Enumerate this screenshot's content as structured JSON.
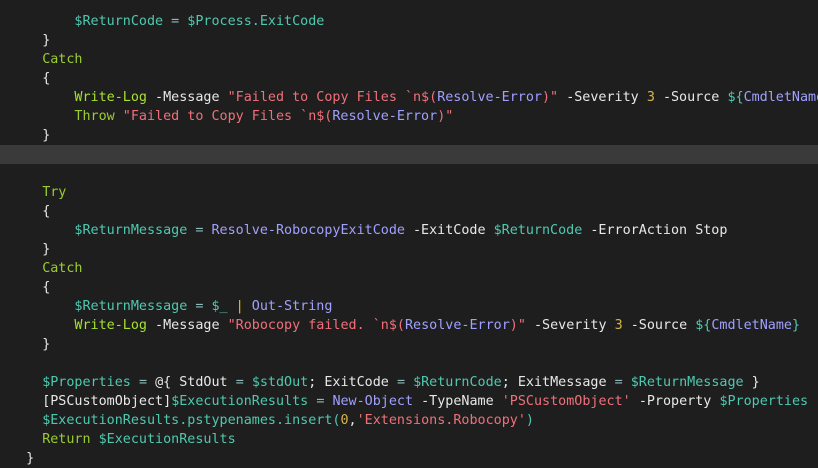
{
  "editor": {
    "current_line_index": 7,
    "colors": {
      "background": "#1e1e1e",
      "current_line": "#3a3a3a",
      "variable": "#4ec9b0",
      "keyword": "#9acd32",
      "command": "#a6e22e",
      "function_call": "#a0a0ff",
      "string": "#f0707a",
      "number": "#d6b64a",
      "operator": "#8fbcbb",
      "pipe": "#f0c000",
      "plain": "#e8e8e8"
    },
    "lines": [
      {
        "indent": 8,
        "tokens": [
          {
            "t": "$ReturnCode",
            "c": "var"
          },
          {
            "t": " ",
            "c": "plain"
          },
          {
            "t": "=",
            "c": "op"
          },
          {
            "t": " ",
            "c": "plain"
          },
          {
            "t": "$Process.ExitCode",
            "c": "var"
          }
        ]
      },
      {
        "indent": 4,
        "tokens": [
          {
            "t": "}",
            "c": "plain"
          }
        ]
      },
      {
        "indent": 4,
        "tokens": [
          {
            "t": "Catch",
            "c": "kw"
          }
        ]
      },
      {
        "indent": 4,
        "tokens": [
          {
            "t": "{",
            "c": "plain"
          }
        ]
      },
      {
        "indent": 8,
        "tokens": [
          {
            "t": "Write-Log",
            "c": "cmd"
          },
          {
            "t": " ",
            "c": "plain"
          },
          {
            "t": "-Message",
            "c": "plain"
          },
          {
            "t": " ",
            "c": "plain"
          },
          {
            "t": "\"Failed to Copy Files `n$(",
            "c": "str"
          },
          {
            "t": "Resolve-Error",
            "c": "fn"
          },
          {
            "t": ")\"",
            "c": "str"
          },
          {
            "t": " ",
            "c": "plain"
          },
          {
            "t": "-Severity",
            "c": "plain"
          },
          {
            "t": " ",
            "c": "plain"
          },
          {
            "t": "3",
            "c": "num"
          },
          {
            "t": " ",
            "c": "plain"
          },
          {
            "t": "-Source",
            "c": "plain"
          },
          {
            "t": " ",
            "c": "plain"
          },
          {
            "t": "${",
            "c": "var"
          },
          {
            "t": "CmdletName",
            "c": "fn"
          },
          {
            "t": "}",
            "c": "var"
          }
        ]
      },
      {
        "indent": 8,
        "tokens": [
          {
            "t": "Throw",
            "c": "kw"
          },
          {
            "t": " ",
            "c": "plain"
          },
          {
            "t": "\"Failed to Copy Files `n$(",
            "c": "str"
          },
          {
            "t": "Resolve-Error",
            "c": "fn"
          },
          {
            "t": ")\"",
            "c": "str"
          }
        ]
      },
      {
        "indent": 4,
        "tokens": [
          {
            "t": "}",
            "c": "plain"
          }
        ]
      },
      {
        "indent": 0,
        "tokens": []
      },
      {
        "indent": 0,
        "tokens": []
      },
      {
        "indent": 4,
        "tokens": [
          {
            "t": "Try",
            "c": "kw"
          }
        ]
      },
      {
        "indent": 4,
        "tokens": [
          {
            "t": "{",
            "c": "plain"
          }
        ]
      },
      {
        "indent": 8,
        "tokens": [
          {
            "t": "$ReturnMessage",
            "c": "var"
          },
          {
            "t": " ",
            "c": "plain"
          },
          {
            "t": "=",
            "c": "op"
          },
          {
            "t": " ",
            "c": "plain"
          },
          {
            "t": "Resolve-RobocopyExitCode",
            "c": "fn"
          },
          {
            "t": " ",
            "c": "plain"
          },
          {
            "t": "-ExitCode",
            "c": "plain"
          },
          {
            "t": " ",
            "c": "plain"
          },
          {
            "t": "$ReturnCode",
            "c": "var"
          },
          {
            "t": " ",
            "c": "plain"
          },
          {
            "t": "-ErrorAction",
            "c": "plain"
          },
          {
            "t": " ",
            "c": "plain"
          },
          {
            "t": "Stop",
            "c": "plain"
          }
        ]
      },
      {
        "indent": 4,
        "tokens": [
          {
            "t": "}",
            "c": "plain"
          }
        ]
      },
      {
        "indent": 4,
        "tokens": [
          {
            "t": "Catch",
            "c": "kw"
          }
        ]
      },
      {
        "indent": 4,
        "tokens": [
          {
            "t": "{",
            "c": "plain"
          }
        ]
      },
      {
        "indent": 8,
        "tokens": [
          {
            "t": "$ReturnMessage",
            "c": "var"
          },
          {
            "t": " ",
            "c": "plain"
          },
          {
            "t": "=",
            "c": "op"
          },
          {
            "t": " ",
            "c": "plain"
          },
          {
            "t": "$_",
            "c": "var"
          },
          {
            "t": " ",
            "c": "plain"
          },
          {
            "t": "|",
            "c": "pipe"
          },
          {
            "t": " ",
            "c": "plain"
          },
          {
            "t": "Out-String",
            "c": "fn"
          }
        ]
      },
      {
        "indent": 8,
        "tokens": [
          {
            "t": "Write-Log",
            "c": "cmd"
          },
          {
            "t": " ",
            "c": "plain"
          },
          {
            "t": "-Message",
            "c": "plain"
          },
          {
            "t": " ",
            "c": "plain"
          },
          {
            "t": "\"Robocopy failed. `n$(",
            "c": "str"
          },
          {
            "t": "Resolve-Error",
            "c": "fn"
          },
          {
            "t": ")\"",
            "c": "str"
          },
          {
            "t": " ",
            "c": "plain"
          },
          {
            "t": "-Severity",
            "c": "plain"
          },
          {
            "t": " ",
            "c": "plain"
          },
          {
            "t": "3",
            "c": "num"
          },
          {
            "t": " ",
            "c": "plain"
          },
          {
            "t": "-Source",
            "c": "plain"
          },
          {
            "t": " ",
            "c": "plain"
          },
          {
            "t": "${",
            "c": "var"
          },
          {
            "t": "CmdletName",
            "c": "fn"
          },
          {
            "t": "}",
            "c": "var"
          }
        ]
      },
      {
        "indent": 4,
        "tokens": [
          {
            "t": "}",
            "c": "plain"
          }
        ]
      },
      {
        "indent": 0,
        "tokens": []
      },
      {
        "indent": 4,
        "tokens": [
          {
            "t": "$Properties",
            "c": "var"
          },
          {
            "t": " ",
            "c": "plain"
          },
          {
            "t": "=",
            "c": "op"
          },
          {
            "t": " ",
            "c": "plain"
          },
          {
            "t": "@{",
            "c": "plain"
          },
          {
            "t": " StdOut ",
            "c": "plain"
          },
          {
            "t": "=",
            "c": "op"
          },
          {
            "t": " ",
            "c": "plain"
          },
          {
            "t": "$stdOut",
            "c": "var"
          },
          {
            "t": "; ExitCode ",
            "c": "plain"
          },
          {
            "t": "=",
            "c": "op"
          },
          {
            "t": " ",
            "c": "plain"
          },
          {
            "t": "$ReturnCode",
            "c": "var"
          },
          {
            "t": "; ExitMessage ",
            "c": "plain"
          },
          {
            "t": "=",
            "c": "op"
          },
          {
            "t": " ",
            "c": "plain"
          },
          {
            "t": "$ReturnMessage",
            "c": "var"
          },
          {
            "t": " }",
            "c": "plain"
          }
        ]
      },
      {
        "indent": 4,
        "tokens": [
          {
            "t": "[PSCustomObject]",
            "c": "plain"
          },
          {
            "t": "$ExecutionResults",
            "c": "var"
          },
          {
            "t": " ",
            "c": "plain"
          },
          {
            "t": "=",
            "c": "op"
          },
          {
            "t": " ",
            "c": "plain"
          },
          {
            "t": "New-Object",
            "c": "fn"
          },
          {
            "t": " ",
            "c": "plain"
          },
          {
            "t": "-TypeName",
            "c": "plain"
          },
          {
            "t": " ",
            "c": "plain"
          },
          {
            "t": "'PSCustomObject'",
            "c": "str"
          },
          {
            "t": " ",
            "c": "plain"
          },
          {
            "t": "-Property",
            "c": "plain"
          },
          {
            "t": " ",
            "c": "plain"
          },
          {
            "t": "$Properties",
            "c": "var"
          }
        ]
      },
      {
        "indent": 4,
        "tokens": [
          {
            "t": "$ExecutionResults.pstypenames.insert(",
            "c": "var"
          },
          {
            "t": "0",
            "c": "num"
          },
          {
            "t": ",",
            "c": "plain"
          },
          {
            "t": "'Extensions.Robocopy'",
            "c": "str"
          },
          {
            "t": ")",
            "c": "var"
          }
        ]
      },
      {
        "indent": 4,
        "tokens": [
          {
            "t": "Return",
            "c": "kw"
          },
          {
            "t": " ",
            "c": "plain"
          },
          {
            "t": "$ExecutionResults",
            "c": "var"
          }
        ]
      },
      {
        "indent": 2,
        "tokens": [
          {
            "t": "}",
            "c": "plain"
          }
        ]
      }
    ]
  }
}
